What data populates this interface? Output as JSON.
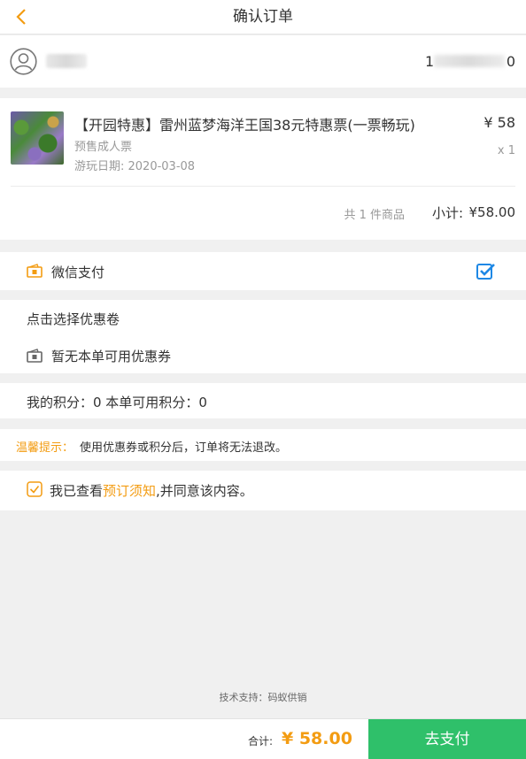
{
  "header": {
    "title": "确认订单"
  },
  "user": {
    "phone_start": "1",
    "phone_end": "0"
  },
  "product": {
    "name": "【开园特惠】雷州蓝梦海洋王国38元特惠票(一票畅玩)",
    "type": "预售成人票",
    "date": "游玩日期: 2020-03-08",
    "price": "¥ 58",
    "qty": "x 1",
    "count": "共 1 件商品",
    "subtotal_label": "小计:",
    "subtotal_value": "¥58.00"
  },
  "payment": {
    "label": "微信支付",
    "selected": true
  },
  "coupon": {
    "title": "点击选择优惠卷",
    "none_text": "暂无本单可用优惠券"
  },
  "points": {
    "text": "我的积分：0 本单可用积分：0"
  },
  "tip": {
    "label": "温馨提示：",
    "text": "使用优惠券或积分后，订单将无法退改。"
  },
  "agreement": {
    "prefix": "我已查看",
    "link": "预订须知",
    "suffix": ",并同意该内容。"
  },
  "support": "技术支持：码蚁供销",
  "footer": {
    "total_label": "合计:",
    "total_value": "¥ 58.00",
    "pay_button": "去支付"
  },
  "colors": {
    "accent": "#f39c12",
    "pay_green": "#2fc06a",
    "check_blue": "#1e88e5"
  }
}
